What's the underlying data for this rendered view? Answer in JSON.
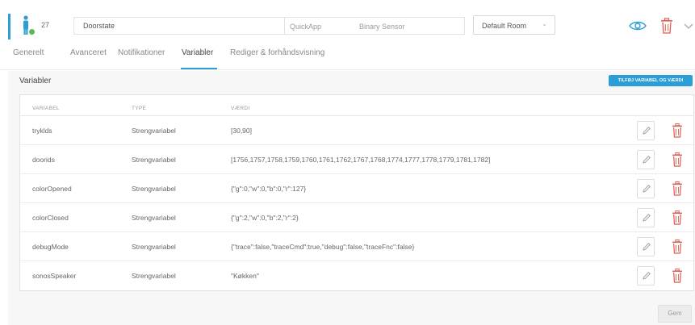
{
  "header": {
    "device_id": "27",
    "device_name": "Doorstate",
    "device_type": "QuickApp",
    "device_role": "Binary Sensor",
    "room": "Default Room",
    "accent_color": "#2b9ed6",
    "icons": [
      "device-person-icon",
      "eye-icon",
      "trash-icon",
      "chevron-down-icon"
    ]
  },
  "tabs": [
    {
      "label": "Generelt",
      "active": false
    },
    {
      "label": "Avanceret",
      "active": false
    },
    {
      "label": "Notifikationer",
      "active": false
    },
    {
      "label": "Variabler",
      "active": true
    },
    {
      "label": "Rediger & forhåndsvisning",
      "active": false
    }
  ],
  "section": {
    "title": "Variabler",
    "add_button": "TILFØJ VARIABEL OG VÆRDI"
  },
  "table": {
    "columns": [
      "VARIABEL",
      "TYPE",
      "VÆRDI"
    ],
    "rows": [
      {
        "name": "tryklds",
        "type": "Strengvariabel",
        "value": "[30,90]"
      },
      {
        "name": "doorids",
        "type": "Strengvariabel",
        "value": "[1756,1757,1758,1759,1760,1761,1762,1767,1768,1774,1777,1778,1779,1781,1782]"
      },
      {
        "name": "colorOpened",
        "type": "Strengvariabel",
        "value": "{\"g\":0,\"w\":0,\"b\":0,\"r\":127}"
      },
      {
        "name": "colorClosed",
        "type": "Strengvariabel",
        "value": "{\"g\":2,\"w\":0,\"b\":2,\"r\":2}"
      },
      {
        "name": "debugMode",
        "type": "Strengvariabel",
        "value": "{\"trace\":false,\"traceCmd\":true,\"debug\":false,\"traceFnc\":false}"
      },
      {
        "name": "sonosSpeaker",
        "type": "Strengvariabel",
        "value": "\"Køkken\""
      }
    ]
  },
  "footer": {
    "save_button": "Gem"
  },
  "colors": {
    "primary": "#2b9ed6",
    "delete": "#e05a4f",
    "status_green": "#5cb85c"
  }
}
